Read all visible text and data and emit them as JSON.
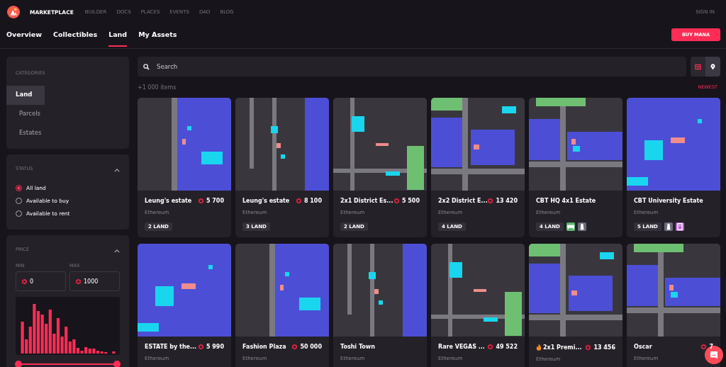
{
  "navbar": {
    "brand": "MARKETPLACE",
    "links": [
      {
        "label": "BUILDER"
      },
      {
        "label": "DOCS"
      },
      {
        "label": "PLACES"
      },
      {
        "label": "EVENTS"
      },
      {
        "label": "DAO"
      },
      {
        "label": "BLOG"
      }
    ],
    "sign_in": "SIGN IN"
  },
  "tabs": [
    {
      "label": "Overview",
      "selected": false
    },
    {
      "label": "Collectibles",
      "selected": false
    },
    {
      "label": "Land",
      "selected": true
    },
    {
      "label": "My Assets",
      "selected": false
    }
  ],
  "buy_button": "BUY MANA",
  "categories": {
    "title": "CATEGORIES",
    "items": [
      {
        "label": "Land",
        "selected": true
      },
      {
        "label": "Parcels",
        "selected": false
      },
      {
        "label": "Estates",
        "selected": false
      }
    ]
  },
  "status": {
    "title": "STATUS",
    "expanded": true,
    "options": [
      {
        "label": "All land",
        "selected": true
      },
      {
        "label": "Available to buy",
        "selected": false
      },
      {
        "label": "Available to rent",
        "selected": false
      }
    ]
  },
  "price": {
    "title": "PRICE",
    "expanded": true,
    "min_label": "MIN",
    "max_label": "MAX",
    "min_value": "0",
    "max_value": "1000",
    "slider": {
      "level": 1
    }
  },
  "search": {
    "placeholder": "Search"
  },
  "view_toggle": [
    {
      "kind": "grid",
      "selected": false
    },
    {
      "kind": "map",
      "selected": true
    }
  ],
  "item_count": "+1 000 items",
  "sort": "NEWEST",
  "cards": [
    {
      "title": "Leung's estate",
      "hot": false,
      "price": "5 700",
      "network": "Ethereum",
      "size": "2 LAND"
    },
    {
      "title": "Leung's estate",
      "hot": false,
      "price": "8 100",
      "network": "Ethereum",
      "size": "3 LAND"
    },
    {
      "title": "2x1 District Es...",
      "hot": false,
      "price": "5 500",
      "network": "Ethereum",
      "size": "2 LAND"
    },
    {
      "title": "2x2 District E...",
      "hot": false,
      "price": "13 420",
      "network": "Ethereum",
      "size": "4 LAND"
    },
    {
      "title": "CBT HQ 4x1 Estate",
      "hot": false,
      "network": "Ethereum",
      "size": "4 LAND",
      "badges": [
        {
          "kind": "road",
          "color": "#5fb36f"
        },
        {
          "kind": "plaza",
          "color": "#6c6b7d"
        }
      ]
    },
    {
      "title": "CBT University Estate",
      "hot": false,
      "network": "Ethereum",
      "size": "5 LAND",
      "badges": [
        {
          "kind": "plaza",
          "color": "#6c6b7d"
        },
        {
          "kind": "district",
          "color": "#b35fc6"
        }
      ]
    },
    {
      "title": "ESTATE by the...",
      "hot": false,
      "price": "5 990",
      "network": "Ethereum"
    },
    {
      "title": "Fashion Plaza",
      "hot": false,
      "price": "50 000",
      "network": "Ethereum"
    },
    {
      "title": "Toshi Town",
      "hot": false,
      "network": "Ethereum"
    },
    {
      "title": "Rare VEGAS ...",
      "hot": false,
      "price": "49 522",
      "network": "Ethereum"
    },
    {
      "title": "2x1 Premi...",
      "hot": true,
      "price": "13 456",
      "network": "Ethereum"
    },
    {
      "title": "Oscar",
      "hot": false,
      "price": "7",
      "network": "Ethereum"
    }
  ]
}
